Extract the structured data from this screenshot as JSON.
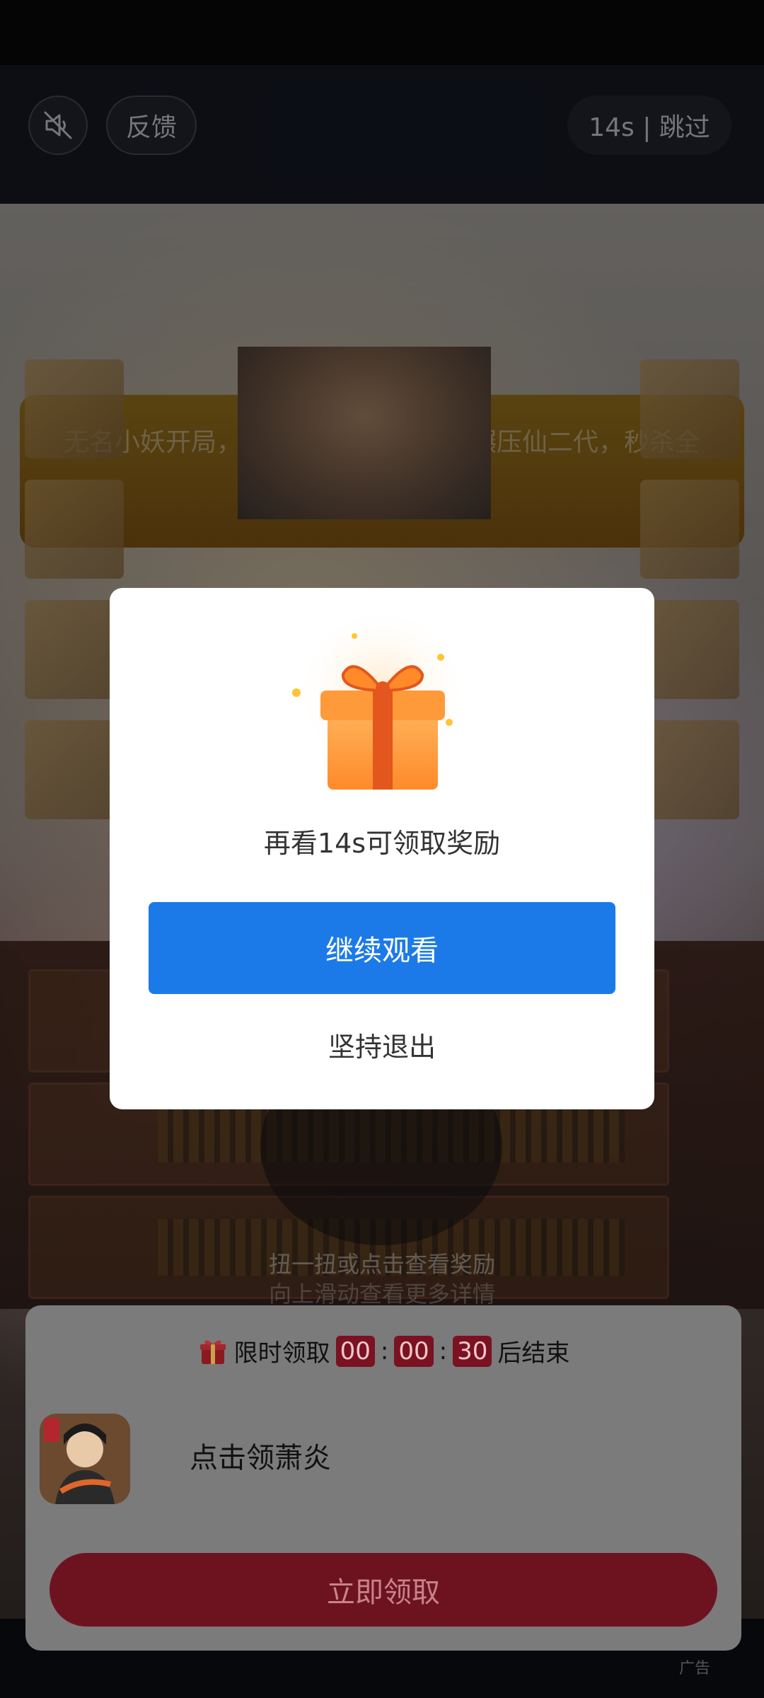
{
  "top_bar": {
    "feedback_label": "反馈",
    "skip_label": "14s | 跳过"
  },
  "ad": {
    "banner_text": "无名小妖开局，无限砍树进化，后期碾压仙二代，秒杀全场！",
    "hint_primary": "扭一扭或点击查看奖励",
    "hint_secondary": "向上滑动查看更多详情",
    "ad_label": "广告"
  },
  "bottom_card": {
    "timer_prefix": "限时领取",
    "timer_hours": "00",
    "timer_minutes": "00",
    "timer_seconds": "30",
    "timer_suffix": "后结束",
    "app_title": "点击领萧炎",
    "claim_button": "立即领取"
  },
  "dialog": {
    "message": "再看14s可领取奖励",
    "continue_button": "继续观看",
    "exit_button": "坚持退出"
  },
  "colors": {
    "primary_blue": "#1c7ae8",
    "claim_red": "#6d1320",
    "timer_red": "#7a1221"
  }
}
